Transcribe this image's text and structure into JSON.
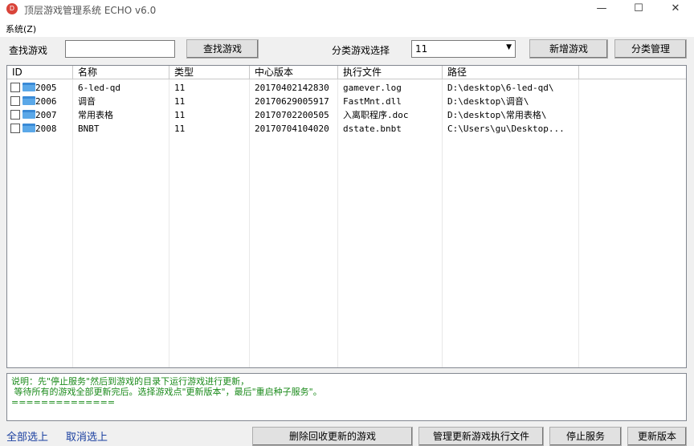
{
  "window": {
    "title": "顶层游戏管理系统  ECHO v6.0",
    "minimize": "—",
    "maximize": "☐",
    "close": "✕"
  },
  "menu": {
    "system": "系统(Z)"
  },
  "toolbar": {
    "search_label": "查找游戏",
    "search_value": "",
    "search_button": "查找游戏",
    "category_label": "分类游戏选择",
    "category_value": "11",
    "add_button": "新增游戏",
    "category_manage_button": "分类管理"
  },
  "table": {
    "columns": [
      "ID",
      "名称",
      "类型",
      "中心版本",
      "执行文件",
      "路径",
      ""
    ],
    "rows": [
      [
        "2005",
        "6-led-qd",
        "11",
        "20170402142830",
        "gamever.log",
        "D:\\desktop\\6-led-qd\\"
      ],
      [
        "2006",
        "调音",
        "11",
        "20170629005917",
        "FastMnt.dll",
        "D:\\desktop\\调音\\"
      ],
      [
        "2007",
        "常用表格",
        "11",
        "20170702200505",
        "入离职程序.doc",
        "D:\\desktop\\常用表格\\"
      ],
      [
        "2008",
        "BNBT",
        "11",
        "20170704104020",
        "dstate.bnbt",
        "C:\\Users\\gu\\Desktop..."
      ]
    ]
  },
  "info": {
    "line1": "说明：先\"停止服务\"然后到游戏的目录下运行游戏进行更新，",
    "line2": " 等待所有的游戏全部更新完后。选择游戏点\"更新版本\"，最后\"重启种子服务\"。",
    "line3": "=============="
  },
  "bottom": {
    "select_all": "全部选上",
    "deselect_all": "取消选上",
    "btn1": "删除回收更新的游戏",
    "btn2": "管理更新游戏执行文件",
    "btn3": "停止服务",
    "btn4": "更新版本"
  }
}
